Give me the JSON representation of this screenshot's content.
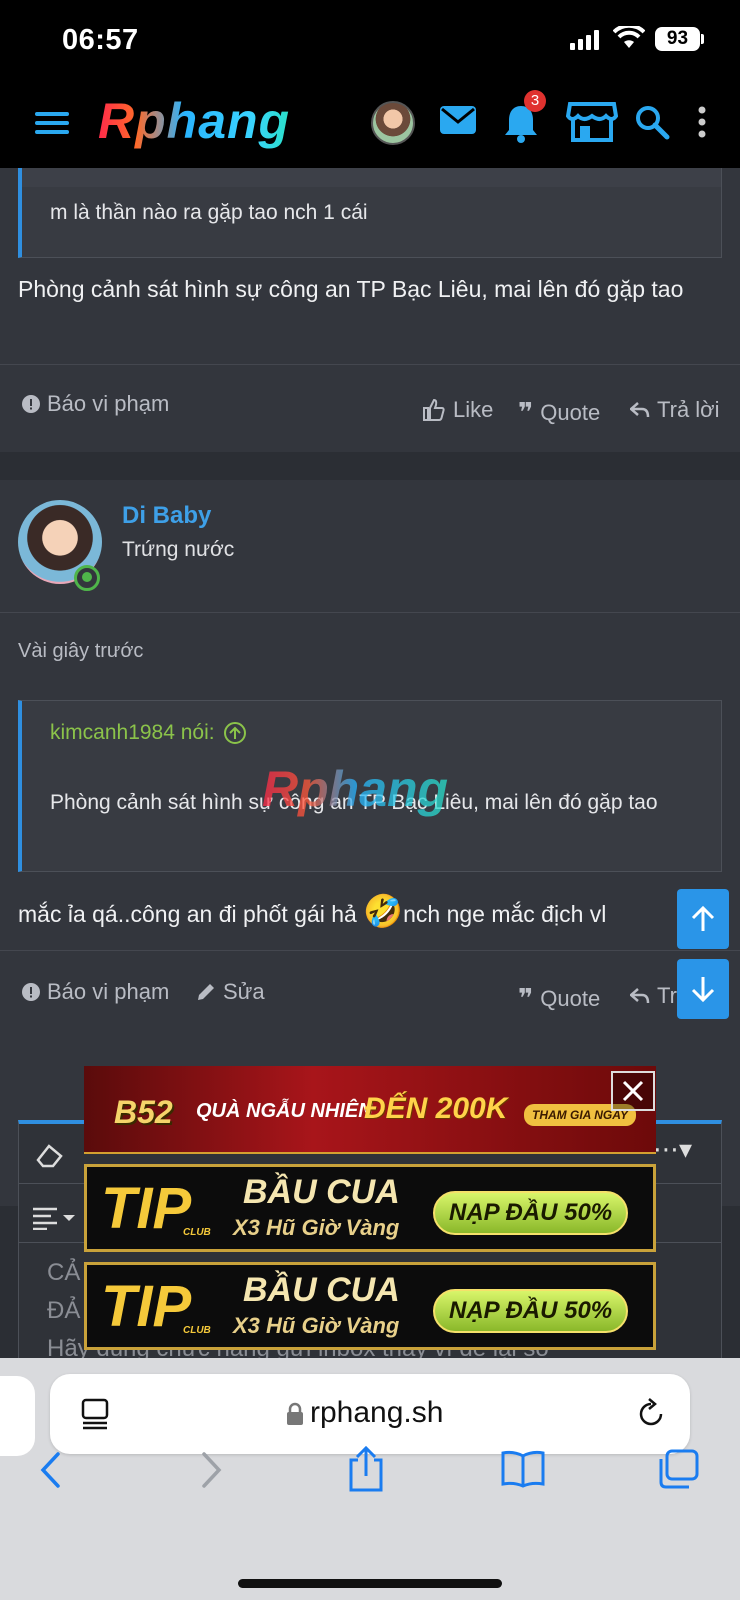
{
  "status": {
    "time": "06:57",
    "battery": "93"
  },
  "header": {
    "logo": "Rphang",
    "notifications_count": "3"
  },
  "post1": {
    "quote_text": "m là thần nào ra gặp tao nch 1 cái",
    "body": "Phòng cảnh sát hình sự công an TP Bạc Liêu, mai lên đó gặp tao",
    "actions": {
      "report": "Báo vi phạm",
      "like": "Like",
      "quote": "Quote",
      "reply": "Trả lời"
    }
  },
  "post2": {
    "username": "Di Baby",
    "user_title": "Trứng nước",
    "timestamp": "Vài giây trước",
    "quote_author": "kimcanh1984 nói:",
    "quote_text": "Phòng cảnh sát hình sự công an TP Bạc Liêu, mai lên đó gặp tao",
    "body_before_emoji": "mắc ỉa qá..công an đi phốt gái hả ",
    "emoji": "🤣",
    "body_after_emoji": "nch nge mắc địch vl",
    "actions": {
      "report": "Báo vi phạm",
      "edit": "Sửa",
      "quote": "Quote",
      "reply": "Tr"
    }
  },
  "watermark": "Rphang",
  "editor": {
    "line1": "CẢ",
    "line2": "ĐẢ",
    "line3": "Hãy dùng chức năng gửi inbox thay vì để lại số"
  },
  "ads": {
    "ad1_brand": "B52",
    "ad1_text1": "QUÀ NGẪU NHIÊN",
    "ad1_text2": "ĐẾN 200K",
    "ad1_cta": "THAM GIA NGAY",
    "tip_brand": "TIP",
    "tip_club": "CLUB",
    "tip_title": "BẦU CUA",
    "tip_sub": "X3 Hũ Giờ Vàng",
    "tip_cta": "NẠP ĐẦU 50%"
  },
  "safari": {
    "url": "rphang.sh"
  },
  "colors": {
    "accent": "#2f8fe0",
    "username": "#3ea0e8",
    "quote_author": "#8bc34a",
    "online": "#4fb54a"
  }
}
